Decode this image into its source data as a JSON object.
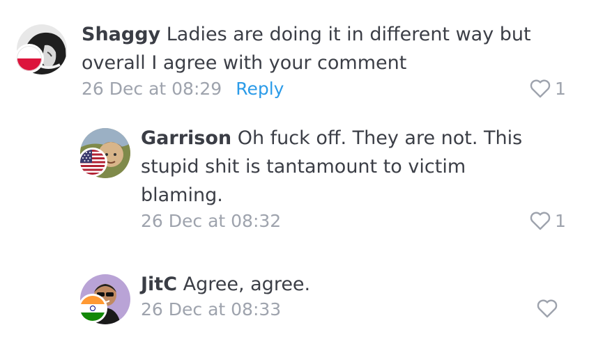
{
  "comments": [
    {
      "author": "Shaggy",
      "text": "Ladies are doing it in different way but overall I agree with your comment",
      "timestamp": "26 Dec at 08:29",
      "reply_label": "Reply",
      "likes": "1",
      "flag": "poland-flag-icon"
    },
    {
      "author": "Garrison",
      "text": "Oh fuck off. They are not. This stupid shit is tantamount to victim blaming.",
      "timestamp": "26 Dec at 08:32",
      "likes": "1",
      "flag": "usa-flag-icon"
    },
    {
      "author": "JitC",
      "text": "Agree, agree.",
      "timestamp": "26 Dec at 08:33",
      "likes": "",
      "flag": "india-flag-icon"
    }
  ],
  "colors": {
    "text": "#3b3e46",
    "meta": "#9ea3ad",
    "link": "#2b9be8"
  }
}
